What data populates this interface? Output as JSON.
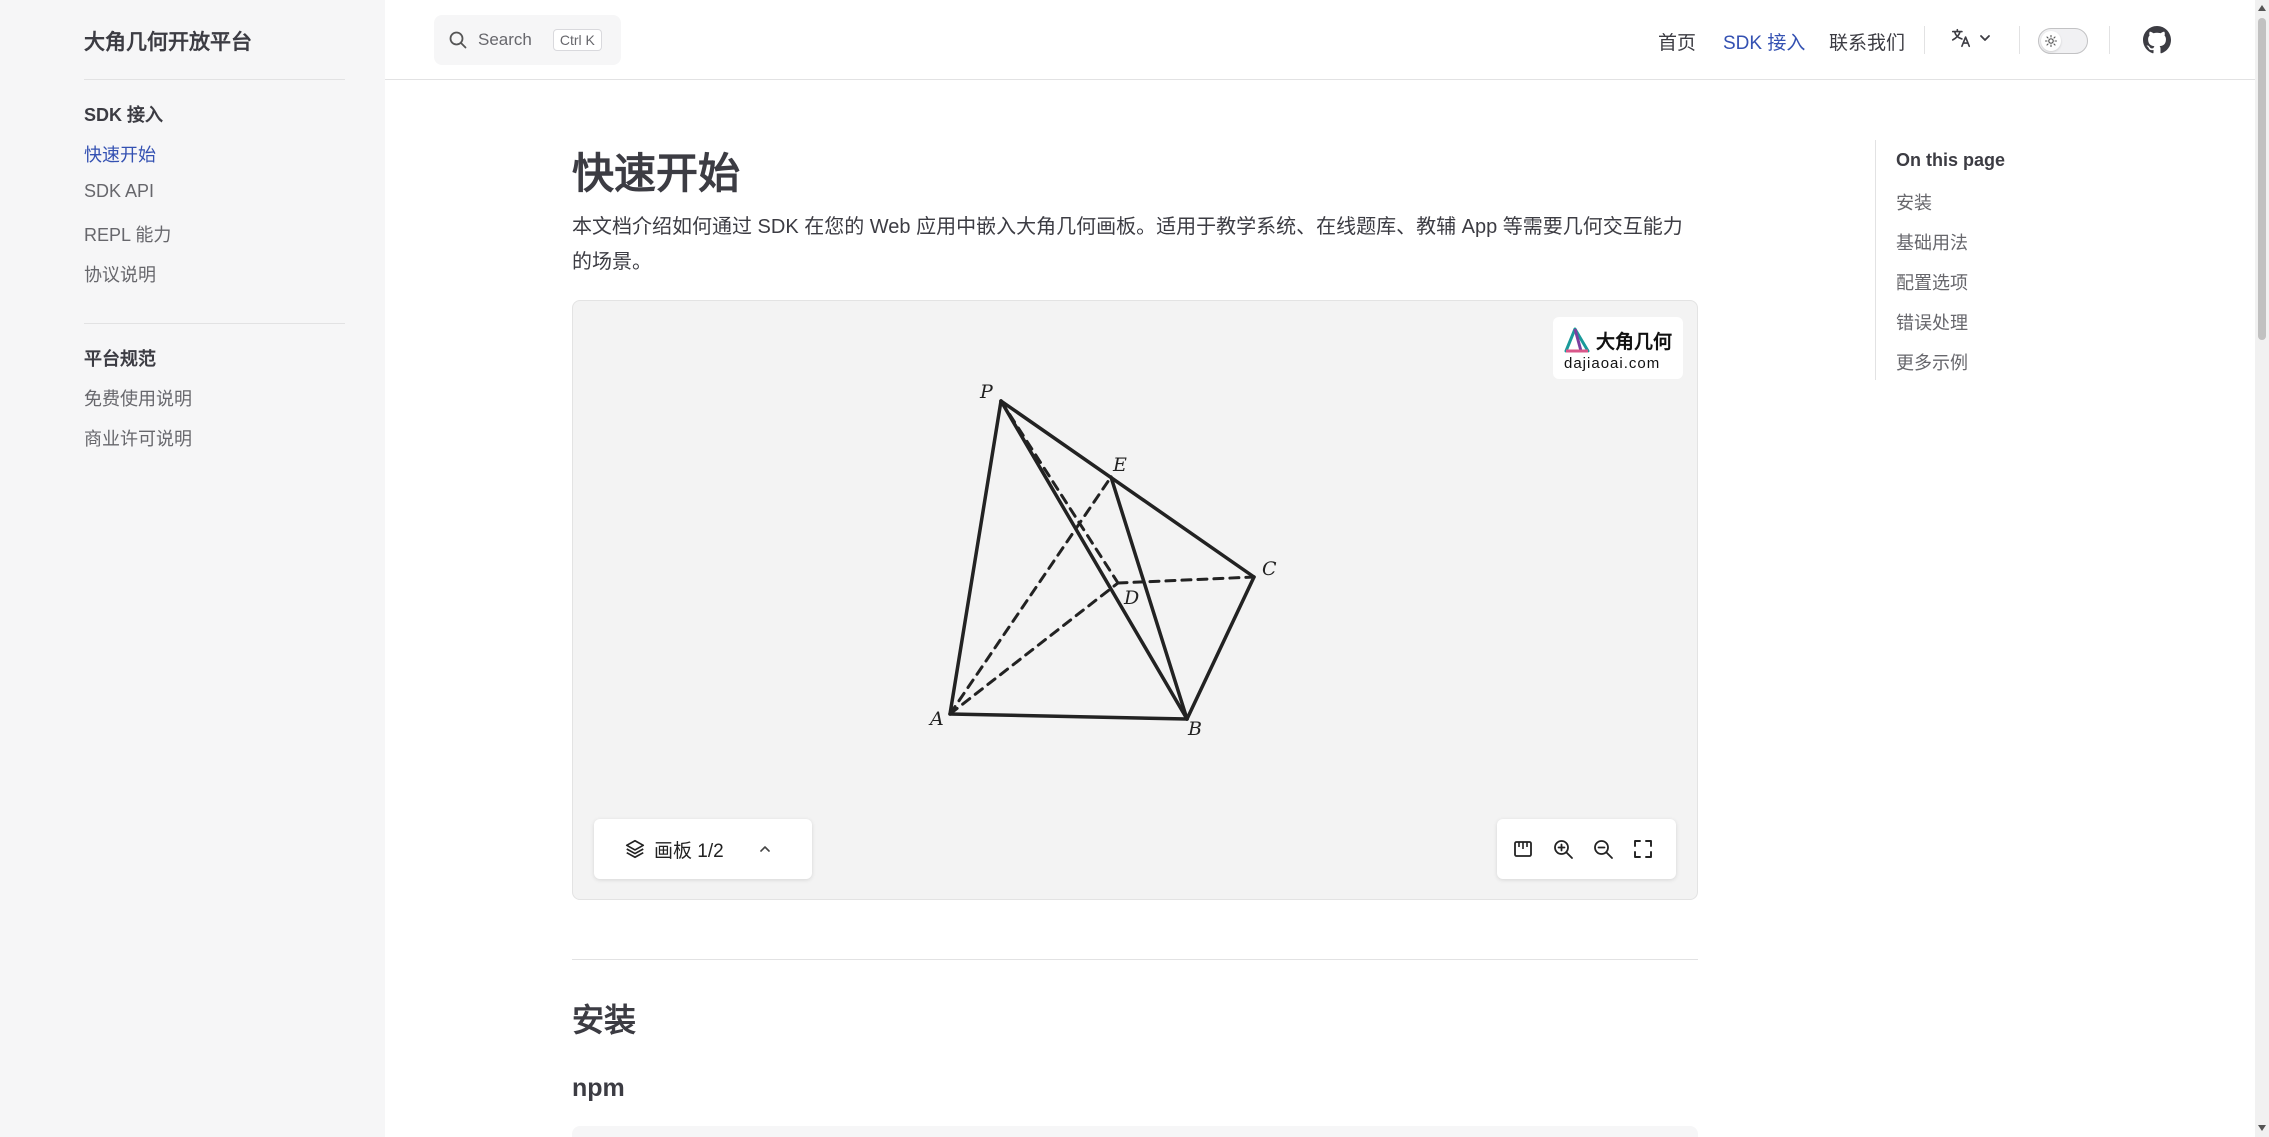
{
  "sidebar": {
    "site_title": "大角几何开放平台",
    "sections": [
      {
        "title": "SDK 接入",
        "items": [
          "快速开始",
          "SDK API",
          "REPL 能力",
          "协议说明"
        ],
        "active": 0
      },
      {
        "title": "平台规范",
        "items": [
          "免费使用说明",
          "商业许可说明"
        ]
      }
    ]
  },
  "topnav": {
    "search_label": "Search",
    "search_kbd": "Ctrl K",
    "links": [
      "首页",
      "SDK 接入",
      "联系我们"
    ],
    "active_link": "SDK 接入"
  },
  "main": {
    "title": "快速开始",
    "intro": "本文档介绍如何通过 SDK 在您的 Web 应用中嵌入大角几何画板。适用于教学系统、在线题库、教辅 App 等需要几何交互能力的场景。",
    "canvas": {
      "logo_name": "大角几何",
      "logo_url": "dajiaoai.com",
      "layer_label": "画板 1/2",
      "point_labels": [
        "P",
        "E",
        "C",
        "D",
        "A",
        "B"
      ]
    },
    "section_title": "安装",
    "subsection_title": "npm"
  },
  "outline": {
    "title": "On this page",
    "items": [
      "安装",
      "基础用法",
      "配置选项",
      "错误处理",
      "更多示例"
    ]
  },
  "colors": {
    "accent": "#3451b2",
    "sidebar_bg": "#f6f6f7",
    "canvas_bg": "#f3f3f3"
  }
}
